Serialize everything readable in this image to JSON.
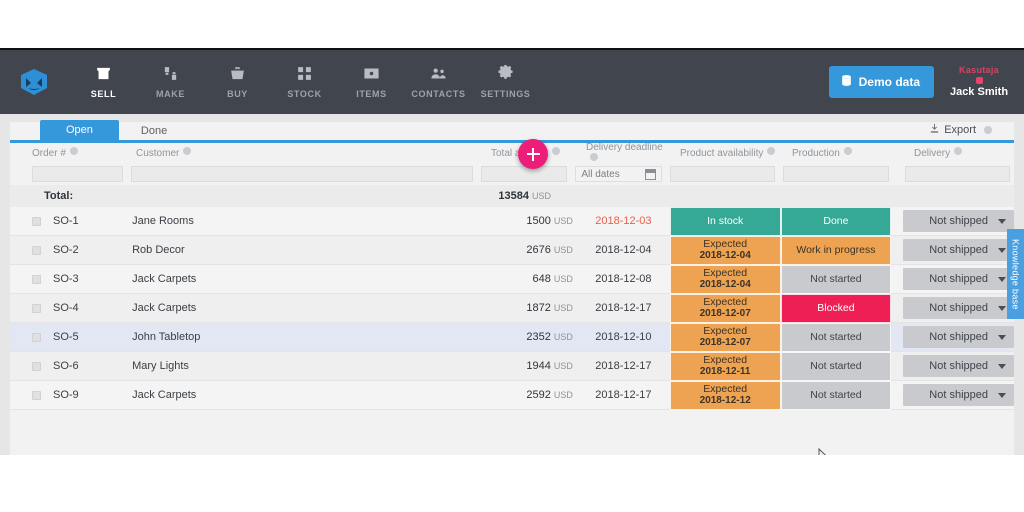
{
  "topnav": {
    "logo_icon": "mrpeasy-logo-icon",
    "items": [
      {
        "label": "SELL",
        "icon": "store-icon",
        "active": true
      },
      {
        "label": "MAKE",
        "icon": "tools-icon",
        "active": false
      },
      {
        "label": "BUY",
        "icon": "basket-icon",
        "active": false
      },
      {
        "label": "STOCK",
        "icon": "boxes-icon",
        "active": false
      },
      {
        "label": "ITEMS",
        "icon": "item-icon",
        "active": false
      },
      {
        "label": "CONTACTS",
        "icon": "contacts-icon",
        "active": false
      },
      {
        "label": "SETTINGS",
        "icon": "gear-icon",
        "active": false
      }
    ],
    "demo_button": "Demo data",
    "demo_icon": "database-icon",
    "user_watermark": "Kasutaja",
    "username": "Jack Smith",
    "add_button_icon": "plus-icon",
    "accent_blue": "#3498db",
    "accent_pink": "#ec1e79",
    "bar_color": "#41464e"
  },
  "tabs": [
    {
      "label": "Open",
      "active": true
    },
    {
      "label": "Done",
      "active": false
    }
  ],
  "export": {
    "label": "Export",
    "icon": "download-icon"
  },
  "knowledge_base": {
    "label": "Knowledge base"
  },
  "table": {
    "headers": [
      "Order #",
      "Customer",
      "Total amount",
      "Delivery deadline",
      "Product availability",
      "Production",
      "Delivery"
    ],
    "filters": {
      "order": "",
      "customer": "",
      "total_amount": "",
      "delivery_deadline": "All dates",
      "product_availability": "",
      "production": "",
      "delivery": ""
    },
    "total_row": {
      "label": "Total:",
      "amount": "13584",
      "currency": "USD"
    },
    "rows": [
      {
        "order": "SO-1",
        "customer": "Jane Rooms",
        "amount": "1500",
        "currency": "USD",
        "deadline": "2018-12-03",
        "deadline_late": true,
        "availability": {
          "text": "In stock",
          "sub": "",
          "color": "teal"
        },
        "production": {
          "text": "Done",
          "color": "teal"
        },
        "delivery": "Not shipped",
        "selected": false
      },
      {
        "order": "SO-2",
        "customer": "Rob Decor",
        "amount": "2676",
        "currency": "USD",
        "deadline": "2018-12-04",
        "deadline_late": false,
        "availability": {
          "text": "Expected",
          "sub": "2018-12-04",
          "color": "orange"
        },
        "production": {
          "text": "Work in progress",
          "color": "orange"
        },
        "delivery": "Not shipped",
        "selected": false
      },
      {
        "order": "SO-3",
        "customer": "Jack Carpets",
        "amount": "648",
        "currency": "USD",
        "deadline": "2018-12-08",
        "deadline_late": false,
        "availability": {
          "text": "Expected",
          "sub": "2018-12-04",
          "color": "orange"
        },
        "production": {
          "text": "Not started",
          "color": "grey"
        },
        "delivery": "Not shipped",
        "selected": false
      },
      {
        "order": "SO-4",
        "customer": "Jack Carpets",
        "amount": "1872",
        "currency": "USD",
        "deadline": "2018-12-17",
        "deadline_late": false,
        "availability": {
          "text": "Expected",
          "sub": "2018-12-07",
          "color": "orange"
        },
        "production": {
          "text": "Blocked",
          "color": "pink"
        },
        "delivery": "Not shipped",
        "selected": false
      },
      {
        "order": "SO-5",
        "customer": "John Tabletop",
        "amount": "2352",
        "currency": "USD",
        "deadline": "2018-12-10",
        "deadline_late": false,
        "availability": {
          "text": "Expected",
          "sub": "2018-12-07",
          "color": "orange"
        },
        "production": {
          "text": "Not started",
          "color": "grey"
        },
        "delivery": "Not shipped",
        "selected": true
      },
      {
        "order": "SO-6",
        "customer": "Mary Lights",
        "amount": "1944",
        "currency": "USD",
        "deadline": "2018-12-17",
        "deadline_late": false,
        "availability": {
          "text": "Expected",
          "sub": "2018-12-11",
          "color": "orange"
        },
        "production": {
          "text": "Not started",
          "color": "grey"
        },
        "delivery": "Not shipped",
        "selected": false
      },
      {
        "order": "SO-9",
        "customer": "Jack Carpets",
        "amount": "2592",
        "currency": "USD",
        "deadline": "2018-12-17",
        "deadline_late": false,
        "availability": {
          "text": "Expected",
          "sub": "2018-12-12",
          "color": "orange"
        },
        "production": {
          "text": "Not started",
          "color": "grey"
        },
        "delivery": "Not shipped",
        "selected": false
      }
    ]
  },
  "colors": {
    "teal": "#36a896",
    "orange": "#eda351",
    "grey": "#c8cacd",
    "pink": "#ed1f55",
    "late_red": "#e8604f"
  }
}
